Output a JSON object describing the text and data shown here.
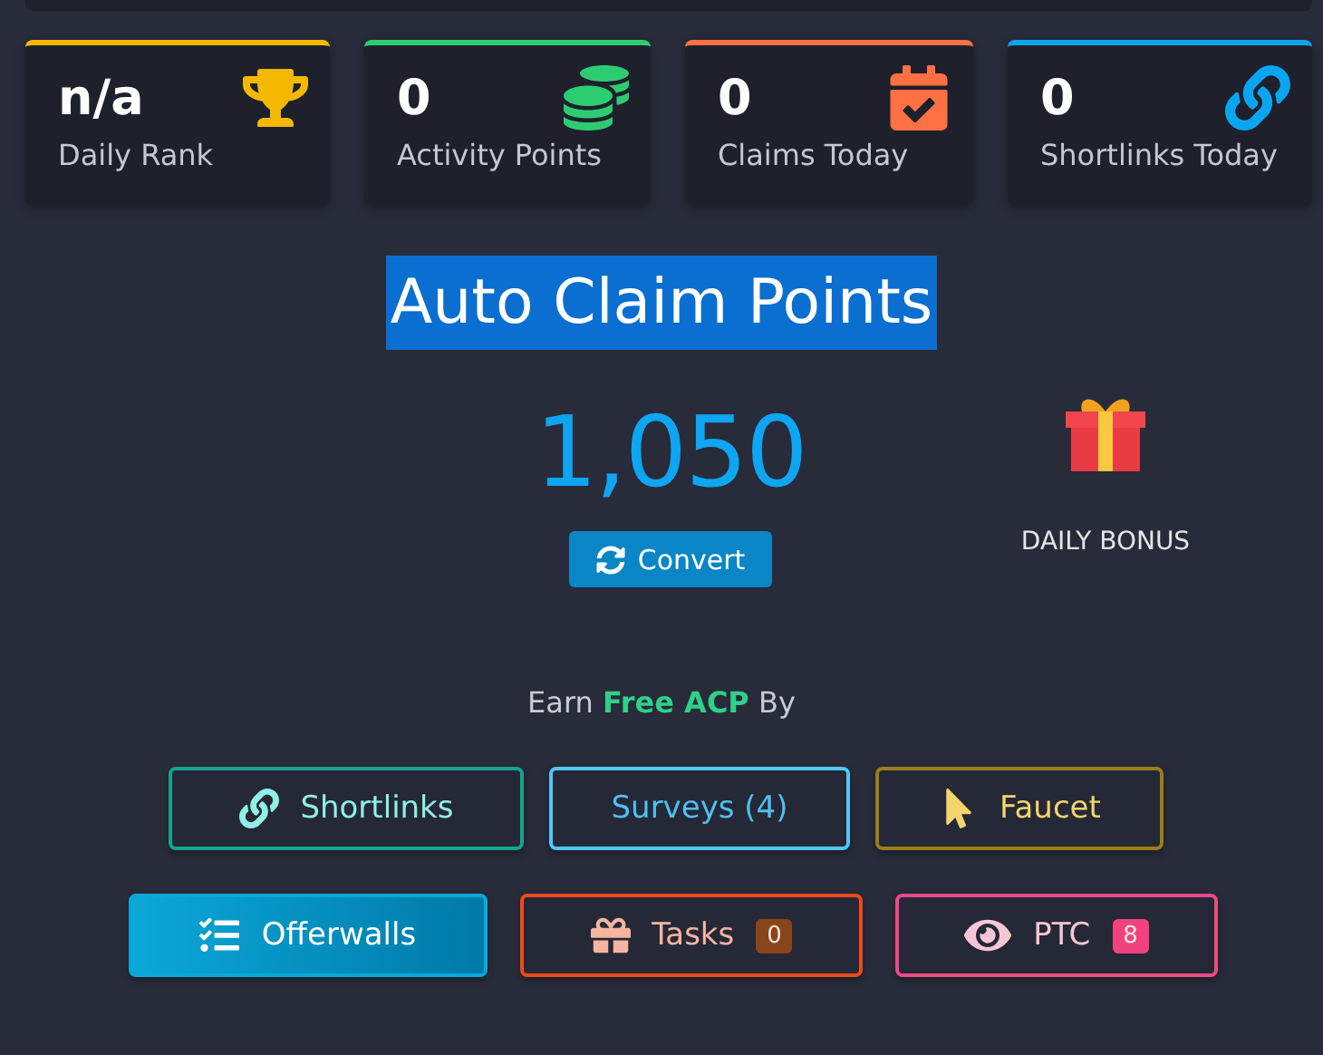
{
  "stats": [
    {
      "value": "n/a",
      "label": "Daily Rank",
      "color": "#f5b800"
    },
    {
      "value": "0",
      "label": "Activity Points",
      "color": "#2ecc71"
    },
    {
      "value": "0",
      "label": "Claims Today",
      "color": "#ff7043"
    },
    {
      "value": "0",
      "label": "Shortlinks Today",
      "color": "#0aa5f0"
    }
  ],
  "title": {
    "text": "Auto Claim Points",
    "highlighted": true
  },
  "points": "1,050",
  "convert_button": "Convert",
  "daily_bonus": "DAILY BONUS",
  "earn_text": "Earn **Free ACP** By",
  "buttons": [
    {
      "label": "Shortlinks",
      "kind": "outline",
      "color": "#13a58f"
    },
    {
      "label": "Surveys (4)",
      "kind": "outline",
      "color": "#4fc8f5"
    },
    {
      "label": "Faucet",
      "kind": "outline",
      "color": "#9a7d1c"
    },
    {
      "label": "Offerwalls",
      "kind": "filled",
      "color": "#0aa8d8"
    },
    {
      "label": "Tasks",
      "kind": "outline",
      "color": "#ee4a1b",
      "badge": {
        "text": "0",
        "color": "#8a4419"
      }
    },
    {
      "label": "PTC",
      "kind": "outline",
      "color": "#ee4a86",
      "badge": {
        "text": "8",
        "color": "#f2427e"
      }
    }
  ]
}
